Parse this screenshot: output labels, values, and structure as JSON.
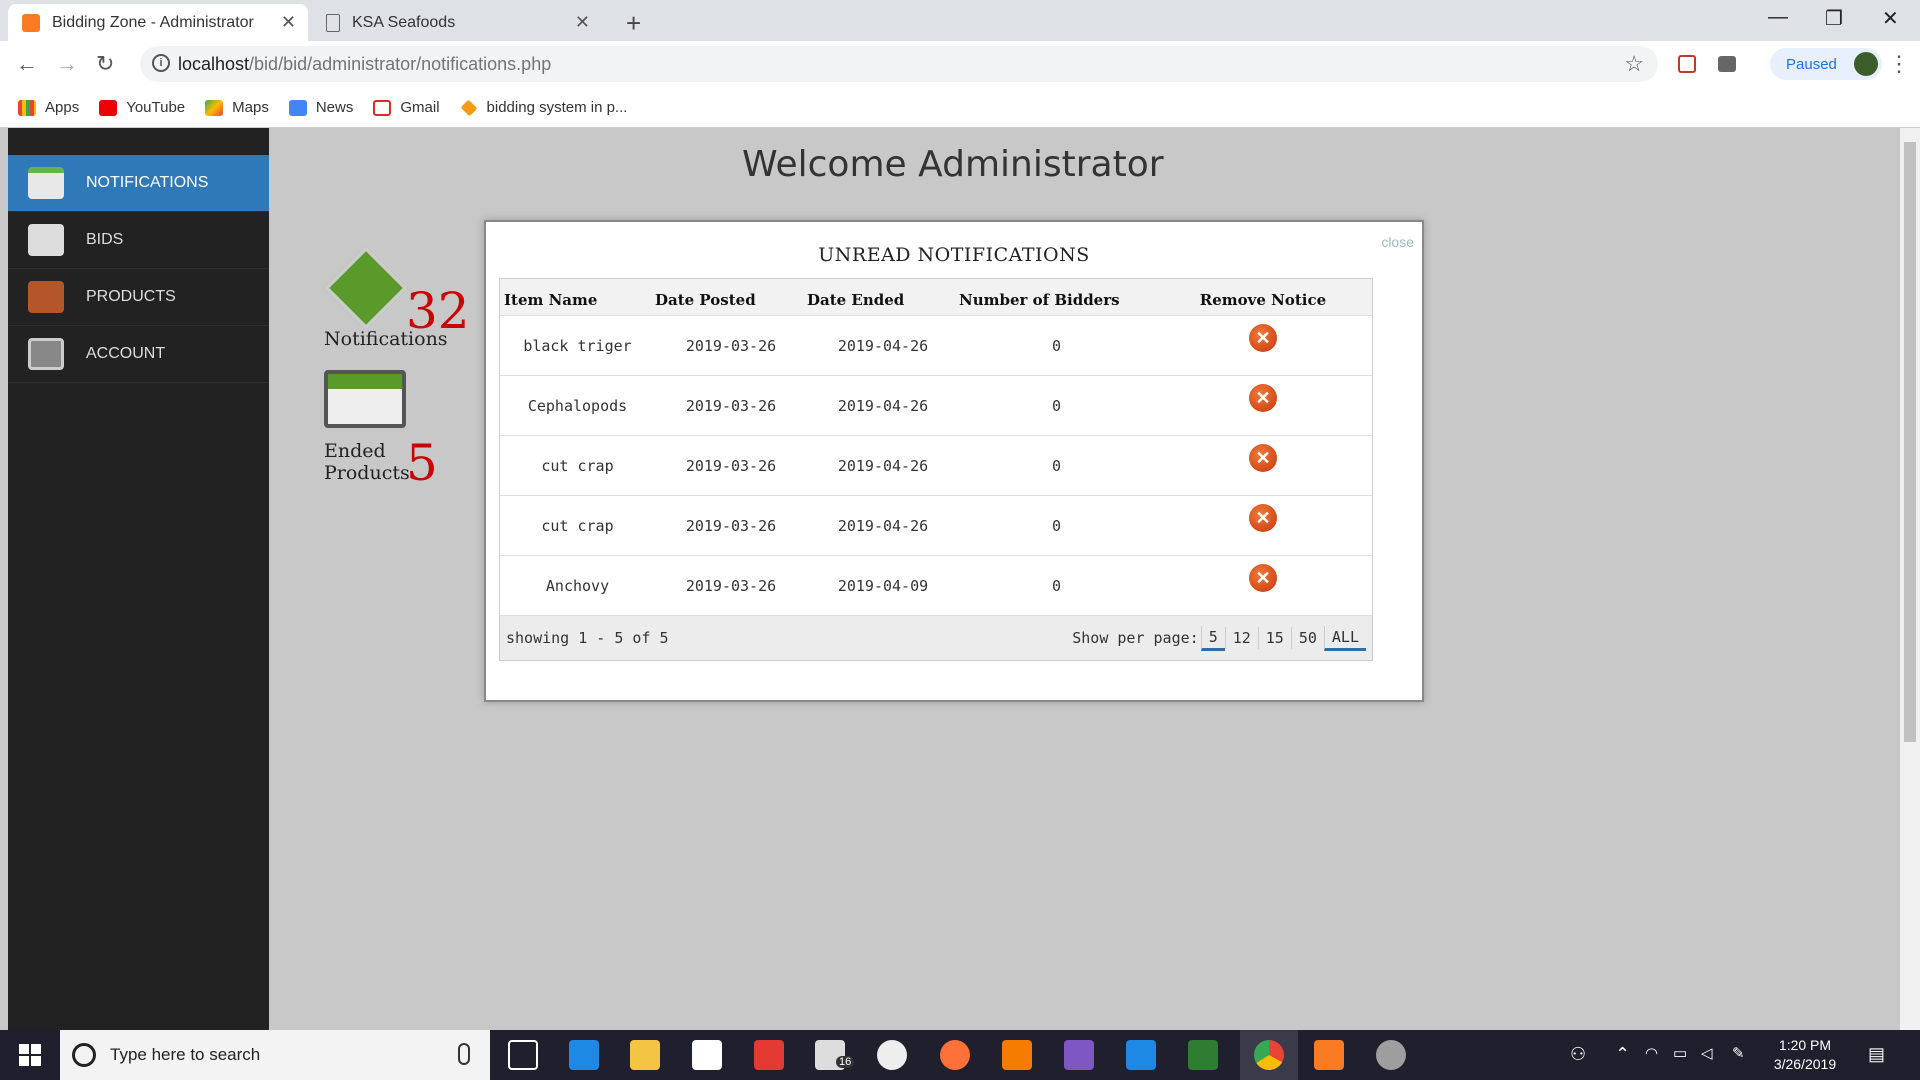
{
  "browser": {
    "tabs": [
      {
        "title": "Bidding Zone - Administrator",
        "active": true
      },
      {
        "title": "KSA Seafoods",
        "active": false
      }
    ],
    "url_host": "localhost",
    "url_path": "/bid/bid/administrator/notifications.php",
    "profile_status": "Paused",
    "bookmarks": [
      "Apps",
      "YouTube",
      "Maps",
      "News",
      "Gmail",
      "bidding system in p..."
    ]
  },
  "sidebar": {
    "items": [
      {
        "label": "NOTIFICATIONS",
        "active": true
      },
      {
        "label": "BIDS",
        "active": false
      },
      {
        "label": "PRODUCTS",
        "active": false
      },
      {
        "label": "ACCOUNT",
        "active": false
      }
    ]
  },
  "page": {
    "title": "Welcome Administrator",
    "stats": {
      "notifications_label": "Notifications",
      "notifications_count": "32",
      "ended_label_1": "Ended",
      "ended_label_2": "Products",
      "ended_count": "5"
    }
  },
  "modal": {
    "title": "UNREAD NOTIFICATIONS",
    "close_alt": "close",
    "columns": [
      "Item Name",
      "Date Posted",
      "Date Ended",
      "Number of Bidders",
      "Remove Notice"
    ],
    "rows": [
      {
        "item": "black triger",
        "posted": "2019-03-26",
        "ended": "2019-04-26",
        "bidders": "0"
      },
      {
        "item": "Cephalopods",
        "posted": "2019-03-26",
        "ended": "2019-04-26",
        "bidders": "0"
      },
      {
        "item": "cut crap",
        "posted": "2019-03-26",
        "ended": "2019-04-26",
        "bidders": "0"
      },
      {
        "item": "cut crap",
        "posted": "2019-03-26",
        "ended": "2019-04-26",
        "bidders": "0"
      },
      {
        "item": "Anchovy",
        "posted": "2019-03-26",
        "ended": "2019-04-09",
        "bidders": "0"
      }
    ],
    "footer": {
      "showing": "showing 1 - 5 of 5",
      "per_page_label": "Show per page:",
      "per_page_options": [
        "5",
        "12",
        "15",
        "50",
        "ALL"
      ]
    }
  },
  "taskbar": {
    "search_placeholder": "Type here to search",
    "time": "1:20 PM",
    "date": "3/26/2019",
    "mail_badge": "16"
  }
}
